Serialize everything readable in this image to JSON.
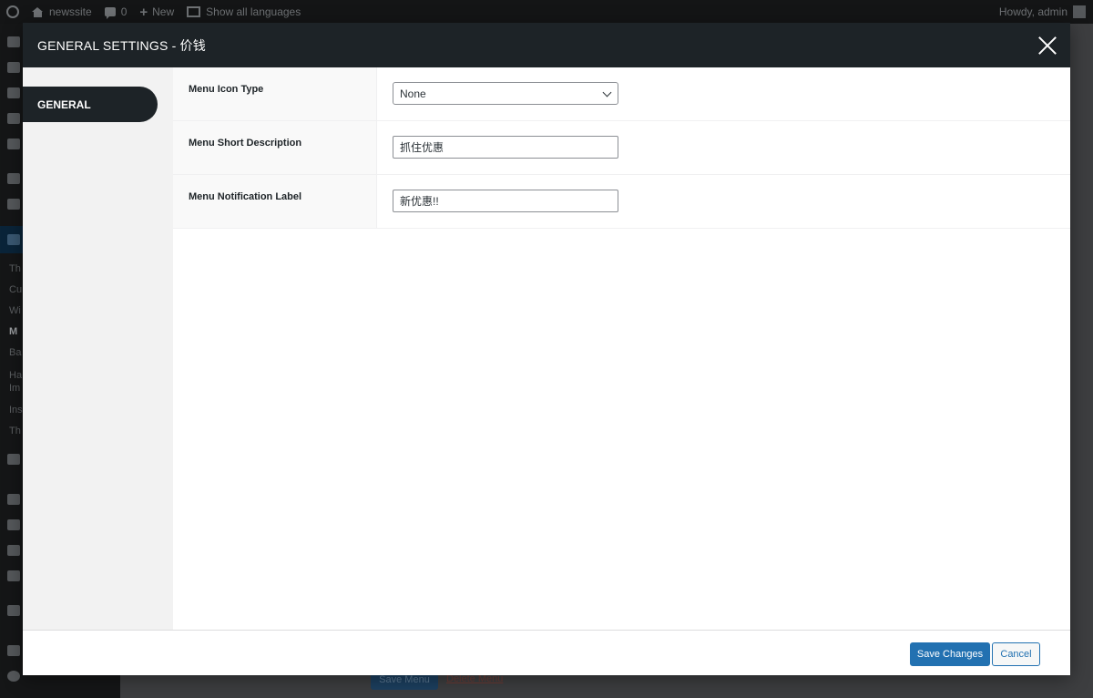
{
  "adminbar": {
    "site_name": "newssite",
    "comments_count": "0",
    "new_label": "New",
    "languages_label": "Show all languages",
    "howdy": "Howdy, admin"
  },
  "sidebar": {
    "labels": [
      "Th",
      "Cu",
      "Wi",
      "M",
      "Ba",
      "Ha",
      "Im",
      "Ins",
      "Th"
    ]
  },
  "back": {
    "save_menu": "Save Menu",
    "delete_menu": "Delete Menu"
  },
  "modal": {
    "title": "GENERAL SETTINGS - 价钱",
    "tabs": [
      {
        "label": "GENERAL",
        "active": true
      }
    ],
    "settings": [
      {
        "label": "Menu Icon Type",
        "type": "select",
        "value": "None"
      },
      {
        "label": "Menu Short Description",
        "type": "text",
        "value": "抓住优惠"
      },
      {
        "label": "Menu Notification Label",
        "type": "text",
        "value": "新优惠!!"
      }
    ],
    "footer": {
      "save_label": "Save Changes",
      "cancel_label": "Cancel"
    }
  },
  "colors": {
    "header_bg": "#1d2327",
    "primary": "#2271b1",
    "tabs_bg": "#f2f2f2"
  }
}
